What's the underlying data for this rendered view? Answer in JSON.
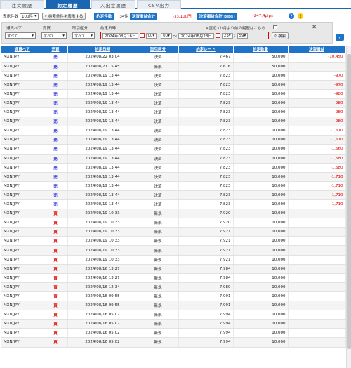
{
  "tabs": [
    "注文履歴",
    "約定履歴",
    "入出金履歴",
    "CSV出力"
  ],
  "toolbar": {
    "display_count_label": "表示件数",
    "display_count_value": "100件",
    "search_button": "検索条件を表示する",
    "contract_count_label": "約定件数",
    "contract_count_value": "34件",
    "settlement_total_label": "決済損益合計",
    "settlement_total_value": "-33,100円",
    "settlement_pips_label": "決済損益合計(pips)",
    "settlement_pips_value": "-247.4pips",
    "help": "?",
    "warn": "!"
  },
  "filter": {
    "pair_label": "通貨ペア",
    "side_label": "売買",
    "type_label": "取引区分",
    "date_label": "約定日時",
    "pair_value": "すべて",
    "side_value": "すべて",
    "type_value": "すべて",
    "date_from": "2024年08月16日",
    "hour_from": "00",
    "min_from": "00",
    "tilde": "〜",
    "date_to": "2024年08月28日",
    "hour_to": "23",
    "min_to": "59",
    "search_button": "検索",
    "history_note": "※直近3カ月より前の履歴はこちら",
    "close": "✕"
  },
  "table": {
    "headers": [
      "通貨ペア",
      "売買",
      "約定日時",
      "取引区分",
      "約定レート",
      "約定数量",
      "決済損益"
    ],
    "rows": [
      [
        "MXN/JPY",
        "売",
        "2024/08/22 03:04",
        "決済",
        "7.467",
        "50,000",
        "-10,450"
      ],
      [
        "MXN/JPY",
        "売",
        "2024/08/21 15:45",
        "新規",
        "7.676",
        "50,000",
        ""
      ],
      [
        "MXN/JPY",
        "売",
        "2024/08/19 13:44",
        "決済",
        "7.823",
        "10,000",
        "-970"
      ],
      [
        "MXN/JPY",
        "売",
        "2024/08/19 13:44",
        "決済",
        "7.823",
        "10,000",
        "-970"
      ],
      [
        "MXN/JPY",
        "売",
        "2024/08/19 13:44",
        "決済",
        "7.823",
        "10,000",
        "-980"
      ],
      [
        "MXN/JPY",
        "売",
        "2024/08/19 13:44",
        "決済",
        "7.823",
        "10,000",
        "-980"
      ],
      [
        "MXN/JPY",
        "売",
        "2024/08/19 13:44",
        "決済",
        "7.823",
        "10,000",
        "-980"
      ],
      [
        "MXN/JPY",
        "売",
        "2024/08/19 13:44",
        "決済",
        "7.823",
        "10,000",
        "-980"
      ],
      [
        "MXN/JPY",
        "売",
        "2024/08/19 13:44",
        "決済",
        "7.823",
        "10,000",
        "-1,610"
      ],
      [
        "MXN/JPY",
        "売",
        "2024/08/19 13:44",
        "決済",
        "7.823",
        "10,000",
        "-1,610"
      ],
      [
        "MXN/JPY",
        "売",
        "2024/08/19 13:44",
        "決済",
        "7.823",
        "10,000",
        "-1,660"
      ],
      [
        "MXN/JPY",
        "売",
        "2024/08/19 13:44",
        "決済",
        "7.823",
        "10,000",
        "-1,680"
      ],
      [
        "MXN/JPY",
        "売",
        "2024/08/19 13:44",
        "決済",
        "7.823",
        "10,000",
        "-1,680"
      ],
      [
        "MXN/JPY",
        "売",
        "2024/08/19 13:44",
        "決済",
        "7.823",
        "10,000",
        "-1,710"
      ],
      [
        "MXN/JPY",
        "売",
        "2024/08/19 13:44",
        "決済",
        "7.823",
        "10,000",
        "-1,710"
      ],
      [
        "MXN/JPY",
        "売",
        "2024/08/19 13:44",
        "決済",
        "7.823",
        "10,000",
        "-1,710"
      ],
      [
        "MXN/JPY",
        "売",
        "2024/08/19 13:44",
        "決済",
        "7.823",
        "10,000",
        "-1,710"
      ],
      [
        "MXN/JPY",
        "買",
        "2024/08/19 10:33",
        "新規",
        "7.920",
        "10,000",
        ""
      ],
      [
        "MXN/JPY",
        "買",
        "2024/08/19 10:33",
        "新規",
        "7.920",
        "10,000",
        ""
      ],
      [
        "MXN/JPY",
        "買",
        "2024/08/19 10:33",
        "新規",
        "7.921",
        "10,000",
        ""
      ],
      [
        "MXN/JPY",
        "買",
        "2024/08/19 10:33",
        "新規",
        "7.921",
        "10,000",
        ""
      ],
      [
        "MXN/JPY",
        "買",
        "2024/08/19 10:33",
        "新規",
        "7.921",
        "10,000",
        ""
      ],
      [
        "MXN/JPY",
        "買",
        "2024/08/19 10:33",
        "新規",
        "7.921",
        "10,000",
        ""
      ],
      [
        "MXN/JPY",
        "買",
        "2024/08/16 13:27",
        "新規",
        "7.984",
        "10,000",
        ""
      ],
      [
        "MXN/JPY",
        "買",
        "2024/08/16 13:27",
        "新規",
        "7.984",
        "10,000",
        ""
      ],
      [
        "MXN/JPY",
        "買",
        "2024/08/16 12:34",
        "新規",
        "7.989",
        "10,000",
        ""
      ],
      [
        "MXN/JPY",
        "買",
        "2024/08/16 09:55",
        "新規",
        "7.991",
        "10,000",
        ""
      ],
      [
        "MXN/JPY",
        "買",
        "2024/08/16 09:55",
        "新規",
        "7.991",
        "10,000",
        ""
      ],
      [
        "MXN/JPY",
        "買",
        "2024/08/16 05:02",
        "新規",
        "7.994",
        "10,000",
        ""
      ],
      [
        "MXN/JPY",
        "買",
        "2024/08/16 05:02",
        "新規",
        "7.994",
        "10,000",
        ""
      ],
      [
        "MXN/JPY",
        "買",
        "2024/08/16 05:02",
        "新規",
        "7.994",
        "10,000",
        ""
      ],
      [
        "MXN/JPY",
        "買",
        "2024/08/16 05:02",
        "新規",
        "7.994",
        "10,000",
        ""
      ]
    ]
  },
  "colors": {
    "accent": "#1f74c9",
    "sell": "#2222dd",
    "buy": "#e00000",
    "loss": "#e00000"
  }
}
